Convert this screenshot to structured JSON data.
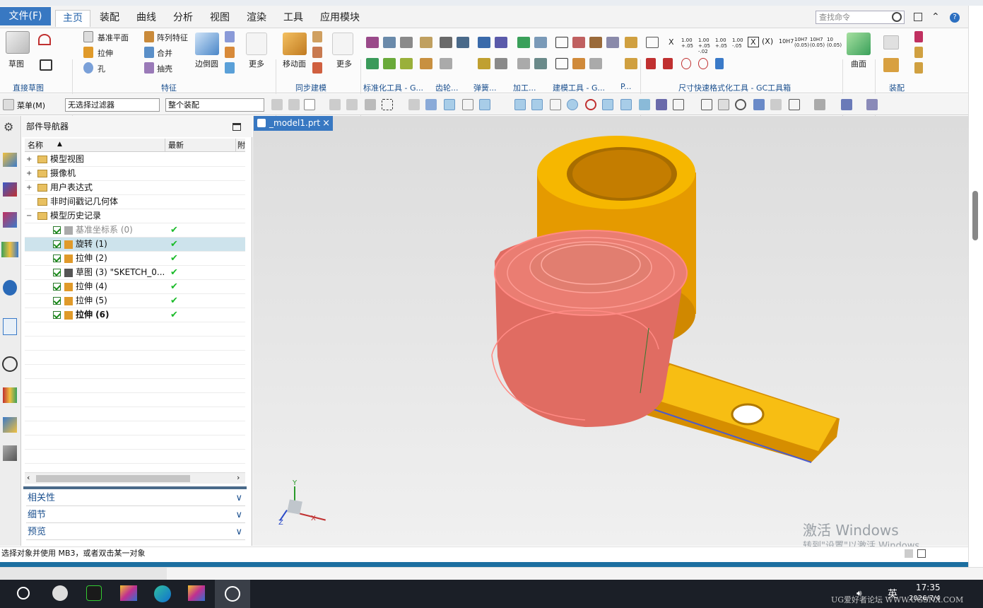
{
  "tabs": {
    "file": "文件(F)",
    "home": "主页",
    "assembly": "装配",
    "curve": "曲线",
    "analysis": "分析",
    "view": "视图",
    "render": "渲染",
    "tools": "工具",
    "app": "应用模块"
  },
  "search_placeholder": "查找命令",
  "ribbon": {
    "sketch": "草图",
    "datum_plane": "基准平面",
    "pattern": "阵列特征",
    "extrude": "拉伸",
    "unite": "合并",
    "hole": "孔",
    "shell": "抽壳",
    "edge_blend": "边倒圆",
    "more": "更多",
    "move_face": "移动面",
    "more2": "更多",
    "curve_btn": "曲面",
    "groups": {
      "direct_sketch": "直接草图",
      "feature": "特征",
      "sync": "同步建模",
      "std": "标准化工具 - G...",
      "gear": "齿轮...",
      "spring": "弹簧...",
      "process": "加工...",
      "modeling": "建模工具 - G...",
      "p": "P...",
      "dim": "尺寸快速格式化工具 - GC工具箱",
      "assembly": "装配"
    },
    "tolerances": [
      "1.00 +.05",
      "1.00 +.05 -.02",
      "1.00 +.05",
      "1.00 -.05",
      "X",
      "(X)",
      "10H7",
      "10H7 (0.05)",
      "10H7 (0.05)",
      "10 (0.05)"
    ]
  },
  "toolbar2": {
    "menu": "菜单(M)",
    "filter": "无选择过滤器",
    "scope": "整个装配"
  },
  "navigator": {
    "title": "部件导航器",
    "col_name": "名称",
    "col_latest": "最新",
    "col_extra": "附",
    "rows": [
      {
        "label": "模型视图",
        "level": 0
      },
      {
        "label": "摄像机",
        "level": 0
      },
      {
        "label": "用户表达式",
        "level": 0
      },
      {
        "label": "非时间戳记几何体",
        "level": 0
      },
      {
        "label": "模型历史记录",
        "level": 0
      },
      {
        "label": "基准坐标系 (0)",
        "level": 1,
        "dim": true
      },
      {
        "label": "旋转 (1)",
        "level": 1,
        "selected": true
      },
      {
        "label": "拉伸 (2)",
        "level": 1
      },
      {
        "label": "草图 (3) \"SKETCH_0...",
        "level": 1
      },
      {
        "label": "拉伸 (4)",
        "level": 1
      },
      {
        "label": "拉伸 (5)",
        "level": 1
      },
      {
        "label": "拉伸 (6)",
        "level": 1,
        "bold": true
      }
    ],
    "panels": [
      "相关性",
      "细节",
      "预览"
    ]
  },
  "viewport": {
    "tab": "_model1.prt",
    "axis_y": "Y",
    "axis_x": "X",
    "axis_z": "Z"
  },
  "status": "选择对象并使用 MB3，或者双击某一对象",
  "watermark": {
    "line1": "激活 Windows",
    "line2": "转到\"设置\"以激活 Windows。"
  },
  "taskbar": {
    "time": "17:35",
    "date": "2026/7/4",
    "lang": "英",
    "site": "UG爱好者论坛  WWW.UGSNX.COM"
  },
  "colors": {
    "accent": "#3878c2",
    "part_orange": "#f2a400",
    "highlight_red": "#e4645c"
  }
}
